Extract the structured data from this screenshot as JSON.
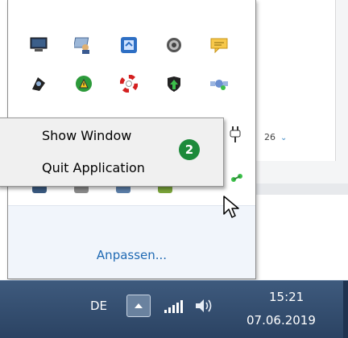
{
  "background": {
    "partial_text": "26",
    "chevron": "chevron-down-icon"
  },
  "tray_flyout": {
    "icons_row1": [
      "monitor-icon",
      "network-users-icon",
      "blue-app-icon",
      "spiral-icon",
      "chat-message-icon"
    ],
    "icons_row2": [
      "bluetooth-icon",
      "update-warning-icon",
      "lifebuoy-icon",
      "shield-up-icon",
      "satellite-icon"
    ],
    "icons_row3_partial": [
      "plug-icon",
      "green-app-icon"
    ],
    "customize_link": "Anpassen..."
  },
  "context_menu": {
    "items": [
      {
        "label": "Show Window"
      },
      {
        "label": "Quit Application"
      }
    ]
  },
  "step_badge": "2",
  "taskbar": {
    "language": "DE",
    "tray_toggle_icon": "triangle-up-icon",
    "time": "15:21",
    "date": "07.06.2019"
  },
  "colors": {
    "taskbar": "#2f4a6c",
    "badge": "#1c8a3a",
    "link": "#1f69b3",
    "menu_bg": "#f0f0f0"
  }
}
